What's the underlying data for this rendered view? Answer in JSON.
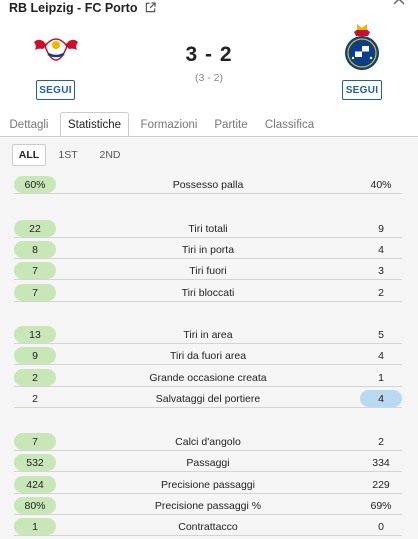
{
  "match": {
    "title": "RB Leipzig - FC Porto",
    "score": "3 - 2",
    "halftime": "(3 - 2)",
    "follow_home": "SEGUI",
    "follow_away": "SEGUI"
  },
  "tabs": [
    "Dettagli",
    "Statistiche",
    "Formazioni",
    "Partite",
    "Classifica"
  ],
  "active_tab": "Statistiche",
  "periods": [
    "ALL",
    "1ST",
    "2ND"
  ],
  "active_period": "ALL",
  "stats": [
    {
      "name": "Possesso palla",
      "home": "60%",
      "away": "40%",
      "leader": "home"
    },
    {
      "name": "Tiri totali",
      "home": "22",
      "away": "9",
      "leader": "home"
    },
    {
      "name": "Tiri in porta",
      "home": "8",
      "away": "4",
      "leader": "home"
    },
    {
      "name": "Tiri fuori",
      "home": "7",
      "away": "3",
      "leader": "home"
    },
    {
      "name": "Tiri bloccati",
      "home": "7",
      "away": "2",
      "leader": "home"
    },
    {
      "name": "Tiri in area",
      "home": "13",
      "away": "5",
      "leader": "home"
    },
    {
      "name": "Tiri da fuori area",
      "home": "9",
      "away": "4",
      "leader": "home"
    },
    {
      "name": "Grande occasione creata",
      "home": "2",
      "away": "1",
      "leader": "home"
    },
    {
      "name": "Salvataggi del portiere",
      "home": "2",
      "away": "4",
      "leader": "away"
    },
    {
      "name": "Calci d'angolo",
      "home": "7",
      "away": "2",
      "leader": "home"
    },
    {
      "name": "Passaggi",
      "home": "532",
      "away": "334",
      "leader": "home"
    },
    {
      "name": "Precisione passaggi",
      "home": "424",
      "away": "229",
      "leader": "home"
    },
    {
      "name": "Precisione passaggi %",
      "home": "80%",
      "away": "69%",
      "leader": "home"
    },
    {
      "name": "Contrattacco",
      "home": "1",
      "away": "0",
      "leader": "home"
    }
  ],
  "colors": {
    "home_highlight": "#c8e6b8",
    "away_highlight": "#b9d9f2",
    "accent": "#1f5fa6"
  }
}
